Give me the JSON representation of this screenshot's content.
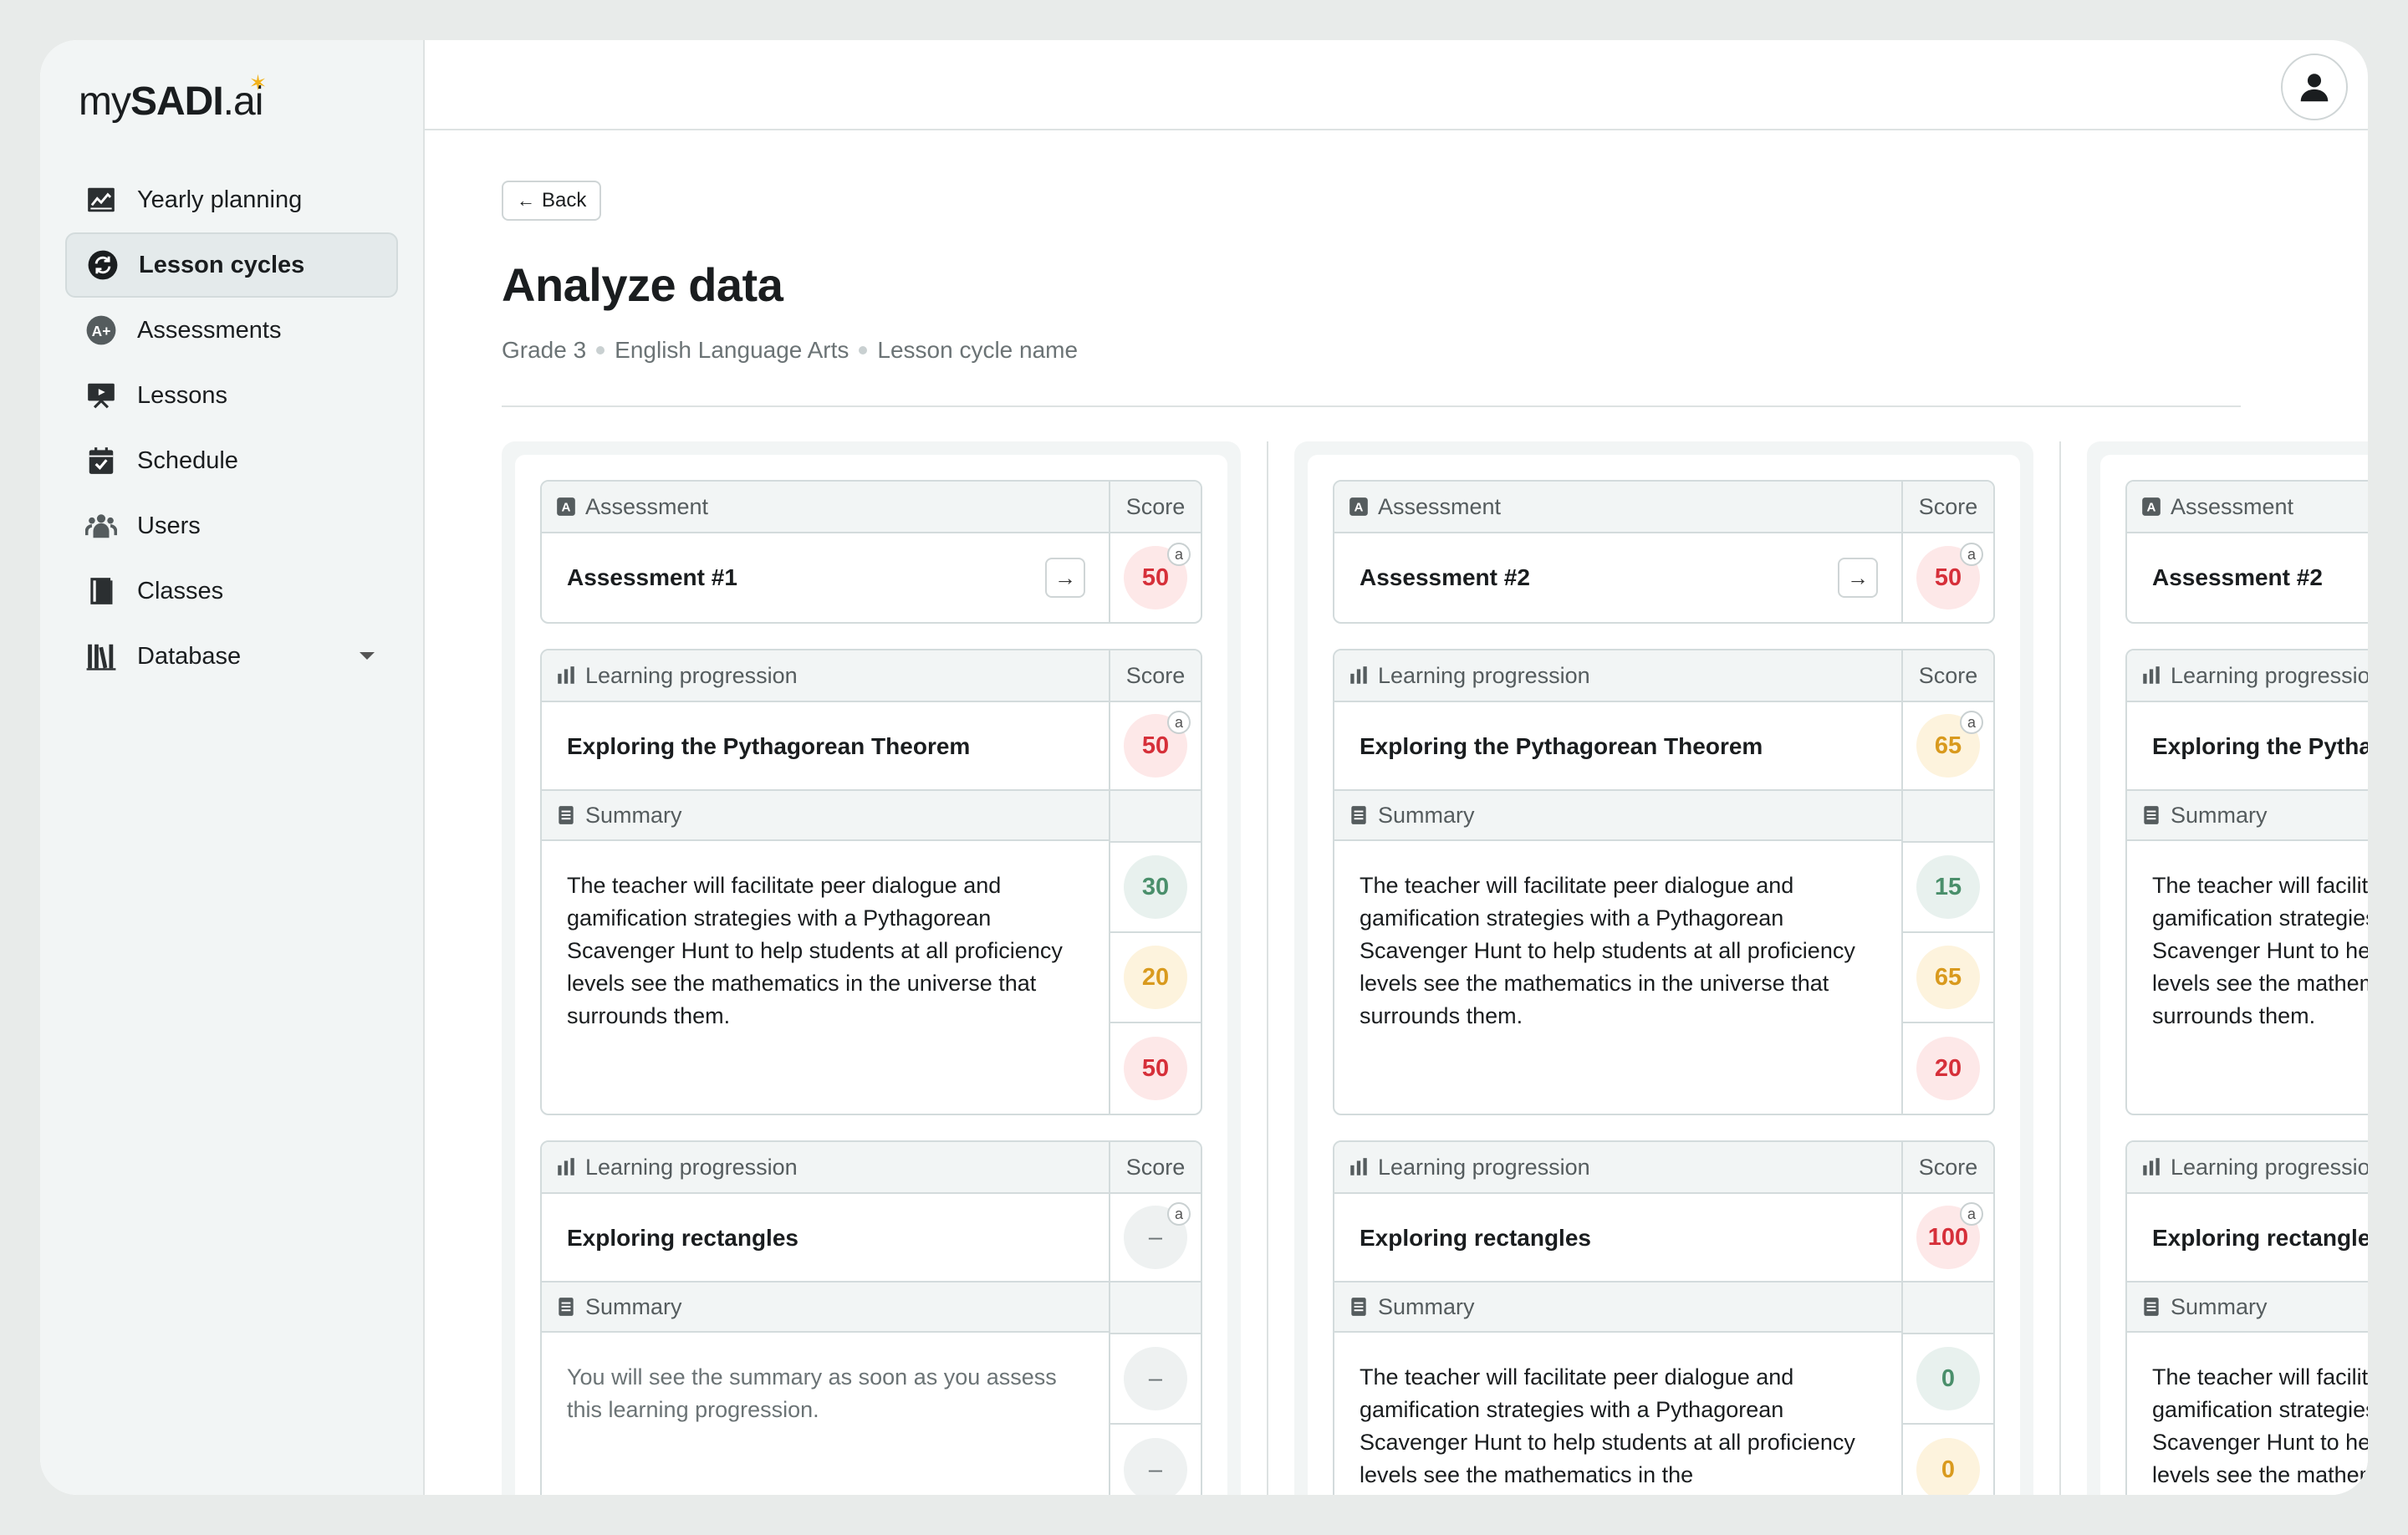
{
  "logo": {
    "part1": "my",
    "part2": "SADI",
    "part3": ".ai"
  },
  "sidebar": {
    "items": [
      {
        "label": "Yearly planning",
        "icon": "chart-line-icon"
      },
      {
        "label": "Lesson cycles",
        "icon": "cycle-icon"
      },
      {
        "label": "Assessments",
        "icon": "a-plus-icon"
      },
      {
        "label": "Lessons",
        "icon": "presentation-icon"
      },
      {
        "label": "Schedule",
        "icon": "calendar-check-icon"
      },
      {
        "label": "Users",
        "icon": "users-icon"
      },
      {
        "label": "Classes",
        "icon": "book-icon"
      },
      {
        "label": "Database",
        "icon": "library-icon"
      }
    ]
  },
  "page": {
    "back_label": "Back",
    "title": "Analyze data",
    "breadcrumb": [
      "Grade 3",
      "English Language Arts",
      "Lesson cycle name"
    ]
  },
  "labels": {
    "assessment": "Assessment",
    "score": "Score",
    "learning_progression": "Learning progression",
    "summary": "Summary",
    "superscript": "a"
  },
  "columns": [
    {
      "assessment": {
        "name": "Assessment #1",
        "score": "50",
        "tone": "red"
      },
      "progressions": [
        {
          "name": "Exploring the Pythagorean Theorem",
          "score": "50",
          "tone": "red",
          "summary": "The teacher will facilitate peer dialogue and gamification strategies with a Pythagorean Scavenger Hunt to help students at all proficiency levels see the mathematics in the universe that surrounds them.",
          "summary_muted": false,
          "sub_scores": [
            {
              "value": "30",
              "tone": "green"
            },
            {
              "value": "20",
              "tone": "yellow"
            },
            {
              "value": "50",
              "tone": "red"
            }
          ]
        },
        {
          "name": "Exploring rectangles",
          "score": "–",
          "tone": "grey",
          "summary": "You will see the summary as soon as you assess this learning progression.",
          "summary_muted": true,
          "sub_scores": [
            {
              "value": "–",
              "tone": "grey"
            },
            {
              "value": "–",
              "tone": "grey"
            }
          ]
        }
      ]
    },
    {
      "assessment": {
        "name": "Assessment #2",
        "score": "50",
        "tone": "red"
      },
      "progressions": [
        {
          "name": "Exploring the Pythagorean Theorem",
          "score": "65",
          "tone": "yellow",
          "summary": "The teacher will facilitate peer dialogue and gamification strategies with a Pythagorean Scavenger Hunt to help students at all proficiency levels see the mathematics in the universe that surrounds them.",
          "summary_muted": false,
          "sub_scores": [
            {
              "value": "15",
              "tone": "green"
            },
            {
              "value": "65",
              "tone": "yellow"
            },
            {
              "value": "20",
              "tone": "red"
            }
          ]
        },
        {
          "name": "Exploring rectangles",
          "score": "100",
          "tone": "red",
          "summary": "The teacher will facilitate peer dialogue and gamification strategies with a Pythagorean Scavenger Hunt to help students at all proficiency levels see the mathematics in the",
          "summary_muted": false,
          "sub_scores": [
            {
              "value": "0",
              "tone": "green"
            },
            {
              "value": "0",
              "tone": "yellow"
            }
          ]
        }
      ]
    },
    {
      "assessment": {
        "name": "Assessment #2",
        "score": "",
        "tone": "red"
      },
      "progressions": [
        {
          "name": "Exploring the Pythagorean Theorem",
          "score": "",
          "tone": "yellow",
          "summary": "The teacher will facilitate peer dialogue and gamification strategies with a Pythagorean Scavenger Hunt to help students at all proficiency levels see the mathematics in the universe that surrounds them.",
          "summary_muted": false,
          "sub_scores": []
        },
        {
          "name": "Exploring rectangles",
          "score": "",
          "tone": "red",
          "summary": "The teacher will facilitate peer dialogue and gamification strategies with a Pythagorean Scavenger Hunt to help students at all proficiency levels see the mathematics in the",
          "summary_muted": false,
          "sub_scores": []
        }
      ]
    }
  ],
  "colors": {
    "accent_star": "#f2b21b",
    "red": "#d6303a",
    "yellow": "#d99a1e",
    "green": "#4a8f6b"
  }
}
